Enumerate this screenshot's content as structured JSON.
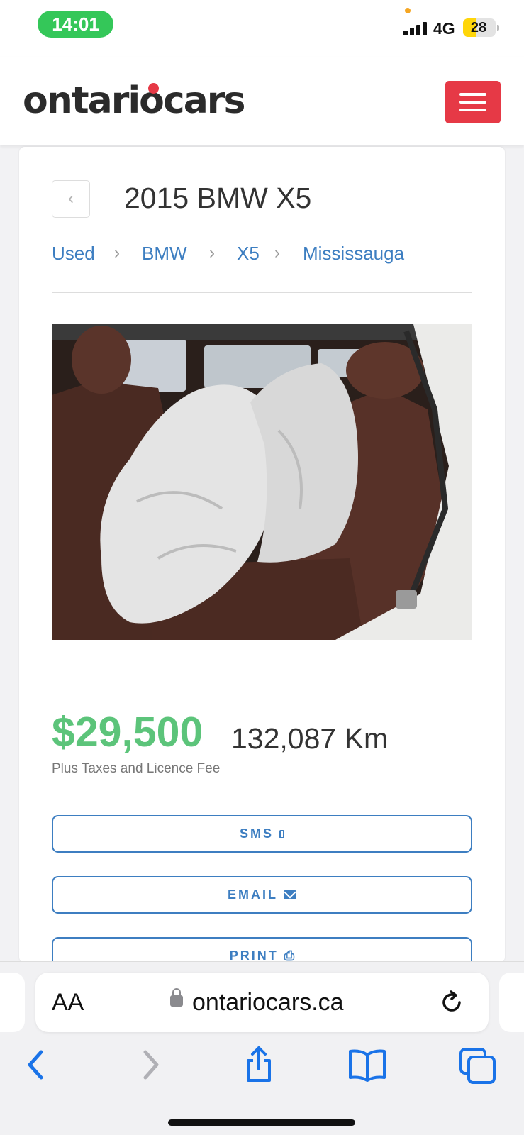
{
  "status_bar": {
    "time": "14:01",
    "network": "4G",
    "battery": "28"
  },
  "header": {
    "logo_text": "ontariocars"
  },
  "listing": {
    "title": "2015 BMW X5",
    "breadcrumbs": [
      "Used",
      "BMW",
      "X5",
      "Mississauga"
    ],
    "price": "$29,500",
    "mileage": "132,087 Km",
    "tax_note": "Plus Taxes and Licence Fee",
    "actions": {
      "sms": "SMS",
      "email": "EMAIL",
      "print": "PRINT"
    }
  },
  "browser": {
    "text_size_label": "AA",
    "url": "ontariocars.ca"
  },
  "colors": {
    "brand_red": "#e63946",
    "price_green": "#5cc47a",
    "link_blue": "#3d7ec1"
  }
}
